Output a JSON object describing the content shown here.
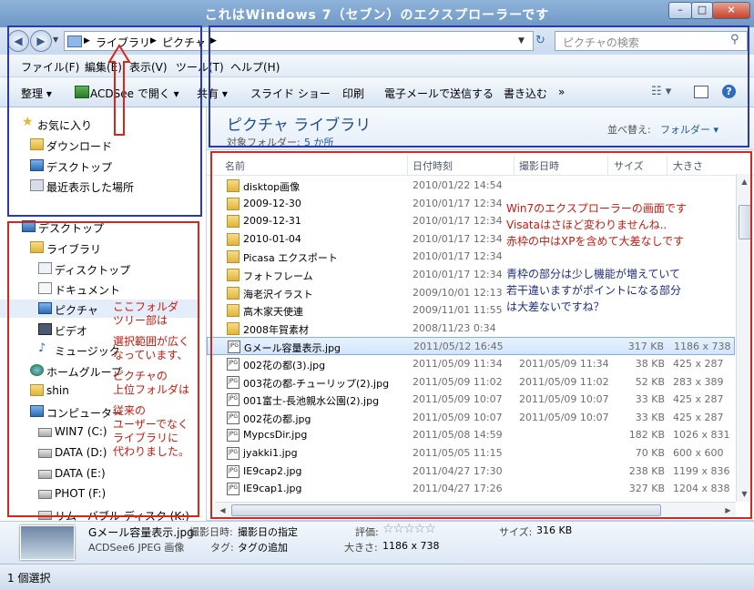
{
  "window": {
    "title": "これはWindows 7（セブン）のエクスプローラーです",
    "controls": [
      "–",
      "□",
      "×"
    ]
  },
  "address": {
    "breadcrumbs": [
      "ライブラリ",
      "ピクチャ"
    ],
    "search_placeholder": "ピクチャの検索"
  },
  "menu": [
    "ファイル(F)",
    "編集(E)",
    "表示(V)",
    "ツール(T)",
    "ヘルプ(H)"
  ],
  "toolbar": {
    "organize": "整理",
    "open_with": "ACDSee で開く",
    "share": "共有",
    "slideshow": "スライド ショー",
    "print": "印刷",
    "email": "電子メールで送信する",
    "burn": "書き込む",
    "more": "»"
  },
  "nav": {
    "favorites": [
      "お気に入り",
      "ダウンロード",
      "デスクトップ",
      "最近表示した場所"
    ],
    "tree": [
      "デスクトップ",
      "ライブラリ",
      "ディスクトップ",
      "ドキュメント",
      "ピクチャ",
      "ビデオ",
      "ミュージック",
      "ホームグループ",
      "shin",
      "コンピューター",
      "WIN7 (C:)",
      "DATA (D:)",
      "DATA (E:)",
      "PHOT (F:)",
      "リムーバブル ディスク (K:)"
    ]
  },
  "library": {
    "title": "ピクチャ ライブラリ",
    "subtitle_label": "対象フォルダー:",
    "subtitle_link": "5 か所",
    "sort_label": "並べ替え:",
    "sort_value": "フォルダー ▾"
  },
  "columns": [
    "名前",
    "日付時刻",
    "撮影日時",
    "サイズ",
    "大きさ"
  ],
  "files": [
    {
      "name": "disktop画像",
      "date": "2010/01/22 14:54",
      "taken": "",
      "size": "",
      "dims": "",
      "type": "folder"
    },
    {
      "name": "2009-12-30",
      "date": "2010/01/17 12:34",
      "taken": "",
      "size": "",
      "dims": "",
      "type": "folder"
    },
    {
      "name": "2009-12-31",
      "date": "2010/01/17 12:34",
      "taken": "",
      "size": "",
      "dims": "",
      "type": "folder"
    },
    {
      "name": "2010-01-04",
      "date": "2010/01/17 12:34",
      "taken": "",
      "size": "",
      "dims": "",
      "type": "folder"
    },
    {
      "name": "Picasa エクスポート",
      "date": "2010/01/17 12:34",
      "taken": "",
      "size": "",
      "dims": "",
      "type": "folder"
    },
    {
      "name": "フォトフレーム",
      "date": "2010/01/17 12:34",
      "taken": "",
      "size": "",
      "dims": "",
      "type": "folder"
    },
    {
      "name": "海老沢イラスト",
      "date": "2009/10/01 12:13",
      "taken": "",
      "size": "",
      "dims": "",
      "type": "folder"
    },
    {
      "name": "高木家天使連",
      "date": "2009/11/01 11:55",
      "taken": "",
      "size": "",
      "dims": "",
      "type": "folder"
    },
    {
      "name": "2008年賀素材",
      "date": "2008/11/23 0:34",
      "taken": "",
      "size": "",
      "dims": "",
      "type": "folder"
    },
    {
      "name": "Gメール容量表示.jpg",
      "date": "2011/05/12 16:45",
      "taken": "",
      "size": "317 KB",
      "dims": "1186 x 738",
      "type": "jpg",
      "selected": true
    },
    {
      "name": "002花の都(3).jpg",
      "date": "2011/05/09 11:34",
      "taken": "2011/05/09 11:34",
      "size": "38 KB",
      "dims": "425 x 287",
      "type": "jpg"
    },
    {
      "name": "003花の都-チューリップ(2).jpg",
      "date": "2011/05/09 11:02",
      "taken": "2011/05/09 11:02",
      "size": "52 KB",
      "dims": "283 x 389",
      "type": "jpg"
    },
    {
      "name": "001富士-長池親水公園(2).jpg",
      "date": "2011/05/09 10:07",
      "taken": "2011/05/09 10:07",
      "size": "33 KB",
      "dims": "425 x 287",
      "type": "jpg"
    },
    {
      "name": "002花の都.jpg",
      "date": "2011/05/09 10:07",
      "taken": "2011/05/09 10:07",
      "size": "33 KB",
      "dims": "425 x 287",
      "type": "jpg"
    },
    {
      "name": "MypcsDir.jpg",
      "date": "2011/05/08 14:59",
      "taken": "",
      "size": "182 KB",
      "dims": "1026 x 831",
      "type": "jpg"
    },
    {
      "name": "jyakki1.jpg",
      "date": "2011/05/05 11:15",
      "taken": "",
      "size": "70 KB",
      "dims": "600 x 600",
      "type": "jpg"
    },
    {
      "name": "IE9cap2.jpg",
      "date": "2011/04/27 17:30",
      "taken": "",
      "size": "238 KB",
      "dims": "1199 x 836",
      "type": "jpg"
    },
    {
      "name": "IE9cap1.jpg",
      "date": "2011/04/27 17:26",
      "taken": "",
      "size": "327 KB",
      "dims": "1204 x 838",
      "type": "jpg"
    }
  ],
  "details": {
    "filename": "Gメール容量表示.jpg",
    "filetype": "ACDSee6 JPEG 画像",
    "taken_label": "撮影日時:",
    "taken_value": "撮影日の指定",
    "tag_label": "タグ:",
    "tag_value": "タグの追加",
    "rating_label": "評価:",
    "rating_stars": "☆☆☆☆☆",
    "dims_label": "大きさ:",
    "dims_value": "1186 x 738",
    "size_label": "サイズ:",
    "size_value": "316 KB"
  },
  "status": "1 個選択",
  "annotations": {
    "tree_note": [
      "ここフォルダ",
      "ツリー部は",
      "",
      "選択範囲が広く",
      "なっています、",
      "",
      "ピクチャの",
      "上位フォルダは",
      "",
      "従来の",
      "ユーザーでなく",
      "ライブラリに",
      "代わりました。"
    ],
    "red_note": [
      "Win7のエクスプローラーの画面です",
      "Visataはさほど変わりませんね..",
      "赤枠の中はXPを含めて大差なしです"
    ],
    "blue_note": [
      "青枠の部分は少し機能が増えていて",
      "若干違いますがポイントになる部分",
      "は大差ないですね？"
    ]
  },
  "colors": {
    "red_frame": "#d9261c",
    "blue_frame": "#2b3aa8",
    "title_text": "#ffffff",
    "library_title": "#1e4e8c"
  }
}
